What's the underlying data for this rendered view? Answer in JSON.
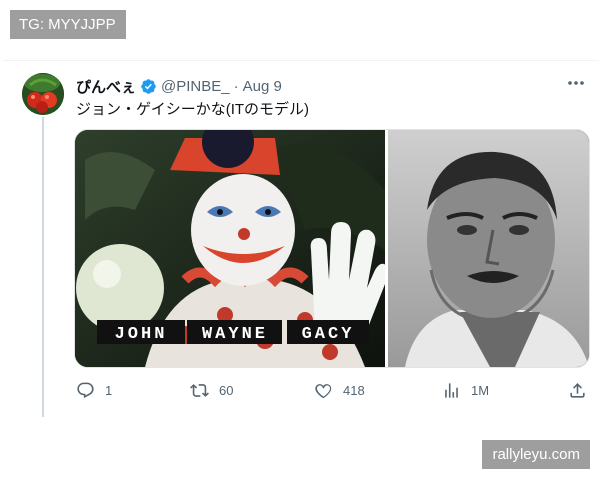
{
  "watermarks": {
    "top": "TG: MYYJJPP",
    "bottom": "rallyleyu.com"
  },
  "tweet": {
    "display_name": "ぴんべぇ",
    "handle": "@PINBE_",
    "separator": "·",
    "date": "Aug 9",
    "text": "ジョン・ゲイシーかな(ITのモデル)",
    "media": {
      "caption_words": [
        "JOHN",
        "WAYNE",
        "GACY"
      ]
    },
    "actions": {
      "reply_count": "1",
      "retweet_count": "60",
      "like_count": "418",
      "views_count": "1M"
    },
    "colors": {
      "verified": "#1d9bf0",
      "secondary_text": "#536471"
    }
  }
}
